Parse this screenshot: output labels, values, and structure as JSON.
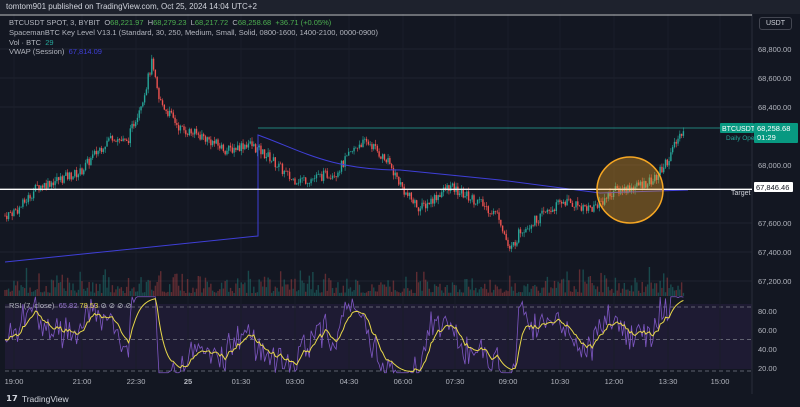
{
  "header": {
    "published": "tomtom901 published on TradingView.com, Oct 25, 2024 14:04 UTC+2"
  },
  "legend": {
    "symbol": "BTCUSDT SPOT, 3, BYBIT",
    "o_label": "O",
    "o": "68,221.97",
    "h_label": "H",
    "h": "68,279.23",
    "l_label": "L",
    "l": "68,217.72",
    "c_label": "C",
    "c": "68,258.68",
    "change": "+36.71 (+0.05%)",
    "indicator": "SpacemanBTC Key Level V13.1 (Standard, 30, 250, Medium, Small, Solid, 0800-1600, 1400-2100, 0000-0900)",
    "vol_label": "Vol · BTC",
    "vol": "29",
    "vwap_label": "VWAP (Session)",
    "vwap": "67,814.09",
    "rsi_label": "RSI (7, close)",
    "rsi": "65.82",
    "rsi_ma": "78.53"
  },
  "currency_button": "USDT",
  "price_labels": {
    "symbol": "BTCUSDT",
    "price": "68,258.68",
    "countdown": "01:29",
    "daily_open": "Daily Open",
    "line": "67,846.46",
    "target": "Target"
  },
  "colors": {
    "up": "#26a69a",
    "down": "#ef5350",
    "vwap": "#3f3fd8",
    "rsi": "#7e57c2",
    "rsi_ma": "#e8d84a",
    "highlight": "#f5a623"
  },
  "chart_data": {
    "type": "candlestick",
    "y_ticks": [
      "68,800.00",
      "68,600.00",
      "68,400.00",
      "68,000.00",
      "67,600.00",
      "67,400.00",
      "67,200.00"
    ],
    "y_tick_values": [
      68800,
      68600,
      68400,
      68000,
      67600,
      67400,
      67200
    ],
    "x_ticks": [
      "19:00",
      "21:00",
      "22:30",
      "25",
      "01:30",
      "03:00",
      "04:30",
      "06:00",
      "07:30",
      "09:00",
      "10:30",
      "12:00",
      "13:30",
      "15:00"
    ],
    "rsi_ticks": [
      "80.00",
      "60.00",
      "40.00",
      "20.00"
    ],
    "rsi_tick_values": [
      80,
      60,
      40,
      20
    ],
    "price_path": [
      [
        0,
        67650
      ],
      [
        8,
        67700
      ],
      [
        18,
        67850
      ],
      [
        30,
        67900
      ],
      [
        42,
        67950
      ],
      [
        52,
        68100
      ],
      [
        60,
        68200
      ],
      [
        68,
        68150
      ],
      [
        78,
        68500
      ],
      [
        82,
        68700
      ],
      [
        86,
        68450
      ],
      [
        98,
        68250
      ],
      [
        110,
        68200
      ],
      [
        124,
        68100
      ],
      [
        136,
        68150
      ],
      [
        148,
        68050
      ],
      [
        160,
        67900
      ],
      [
        170,
        67900
      ],
      [
        185,
        67950
      ],
      [
        198,
        68150
      ],
      [
        204,
        68150
      ],
      [
        215,
        68000
      ],
      [
        224,
        67800
      ],
      [
        232,
        67700
      ],
      [
        248,
        67850
      ],
      [
        264,
        67750
      ],
      [
        276,
        67650
      ],
      [
        282,
        67400
      ],
      [
        288,
        67550
      ],
      [
        300,
        67650
      ],
      [
        312,
        67750
      ],
      [
        328,
        67700
      ],
      [
        340,
        67820
      ],
      [
        352,
        67850
      ],
      [
        363,
        67900
      ],
      [
        371,
        68050
      ],
      [
        379,
        68258
      ]
    ],
    "horizontal_line": 67846.46,
    "daily_open": 68200
  }
}
